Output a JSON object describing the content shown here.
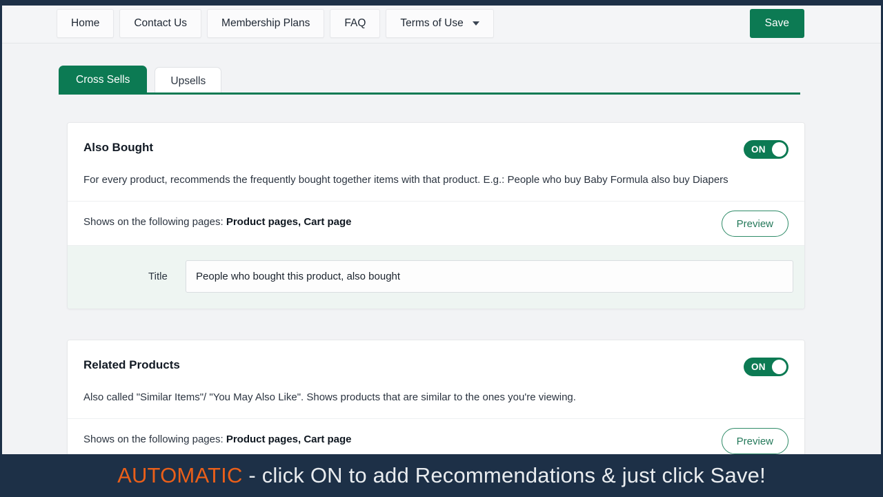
{
  "navbar": {
    "items": [
      {
        "label": "Home",
        "has_caret": false
      },
      {
        "label": "Contact Us",
        "has_caret": false
      },
      {
        "label": "Membership Plans",
        "has_caret": false
      },
      {
        "label": "FAQ",
        "has_caret": false
      },
      {
        "label": "Terms of Use",
        "has_caret": true
      }
    ],
    "save_label": "Save"
  },
  "tabs": [
    {
      "label": "Cross Sells",
      "active": true
    },
    {
      "label": "Upsells",
      "active": false
    }
  ],
  "cards": [
    {
      "title": "Also Bought",
      "description": "For every product, recommends the frequently bought together items with that product. E.g.: People who buy Baby Formula also buy Diapers",
      "toggle_label": "ON",
      "pages_prefix": "Shows on the following pages: ",
      "pages_value": "Product pages, Cart page",
      "preview_label": "Preview",
      "title_label": "Title",
      "title_value": "People who bought this product, also bought",
      "title_placeholder": "Enter a title"
    },
    {
      "title": "Related Products",
      "description": "Also called \"Similar Items\"/ \"You May Also Like\". Shows products that are similar to the ones you're viewing.",
      "toggle_label": "ON",
      "pages_prefix": "Shows on the following pages: ",
      "pages_value": "Product pages, Cart page",
      "preview_label": "Preview"
    }
  ],
  "caption": {
    "highlight": "AUTOMATIC",
    "rest": " - click ON to add Recommendations & just click Save!"
  },
  "colors": {
    "brand_green": "#0c7a53",
    "navy": "#1d3047",
    "orange": "#ea5f19",
    "page_bg": "#f2f3f5",
    "title_row_bg": "#eef5f2"
  }
}
